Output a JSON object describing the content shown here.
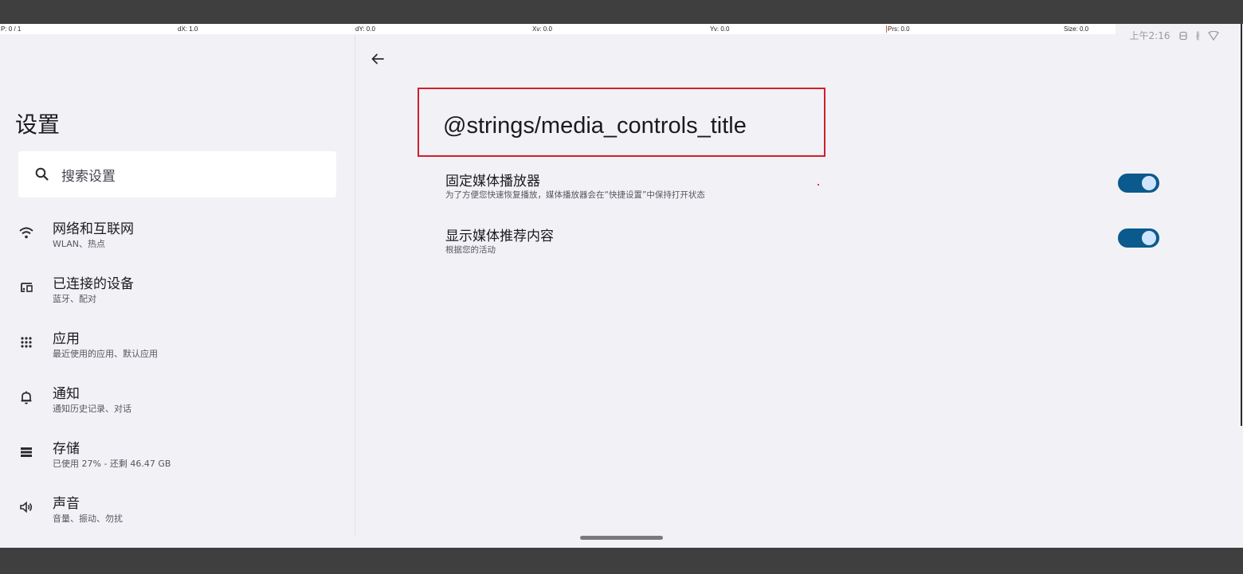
{
  "debug_bar": {
    "p": "P: 0 / 1",
    "dx": "dX: 1.0",
    "dy": "dY: 0.0",
    "xv": "Xv: 0.0",
    "yv": "Yv: 0.0",
    "prs": "Prs: 0.0",
    "size": "Size: 0.0"
  },
  "status_bar": {
    "time": "上午2:16",
    "icons": [
      "sync-icon",
      "bluetooth-icon",
      "wifi-icon"
    ]
  },
  "settings": {
    "title": "设置",
    "search_placeholder": "搜索设置",
    "items": [
      {
        "icon": "wifi-icon",
        "title": "网络和互联网",
        "subtitle": "WLAN、热点"
      },
      {
        "icon": "connected-devices-icon",
        "title": "已连接的设备",
        "subtitle": "蓝牙、配对"
      },
      {
        "icon": "apps-grid-icon",
        "title": "应用",
        "subtitle": "最近使用的应用、默认应用"
      },
      {
        "icon": "bell-icon",
        "title": "通知",
        "subtitle": "通知历史记录、对话"
      },
      {
        "icon": "storage-icon",
        "title": "存储",
        "subtitle": "已使用 27% - 还剩 46.47 GB"
      },
      {
        "icon": "volume-icon",
        "title": "声音",
        "subtitle": "音量、振动、勿扰"
      }
    ]
  },
  "detail": {
    "title": "@strings/media_controls_title",
    "prefs": [
      {
        "title": "固定媒体播放器",
        "subtitle": "为了方便您快速恢复播放，媒体播放器会在“快捷设置”中保持打开状态",
        "enabled": true
      },
      {
        "title": "显示媒体推荐内容",
        "subtitle": "根据您的活动",
        "enabled": true
      }
    ]
  },
  "colors": {
    "toggle_track": "#0b5a8d",
    "toggle_knob": "#cfe5ff",
    "highlight_border": "#d01f2a",
    "background": "#f2f1f6"
  }
}
